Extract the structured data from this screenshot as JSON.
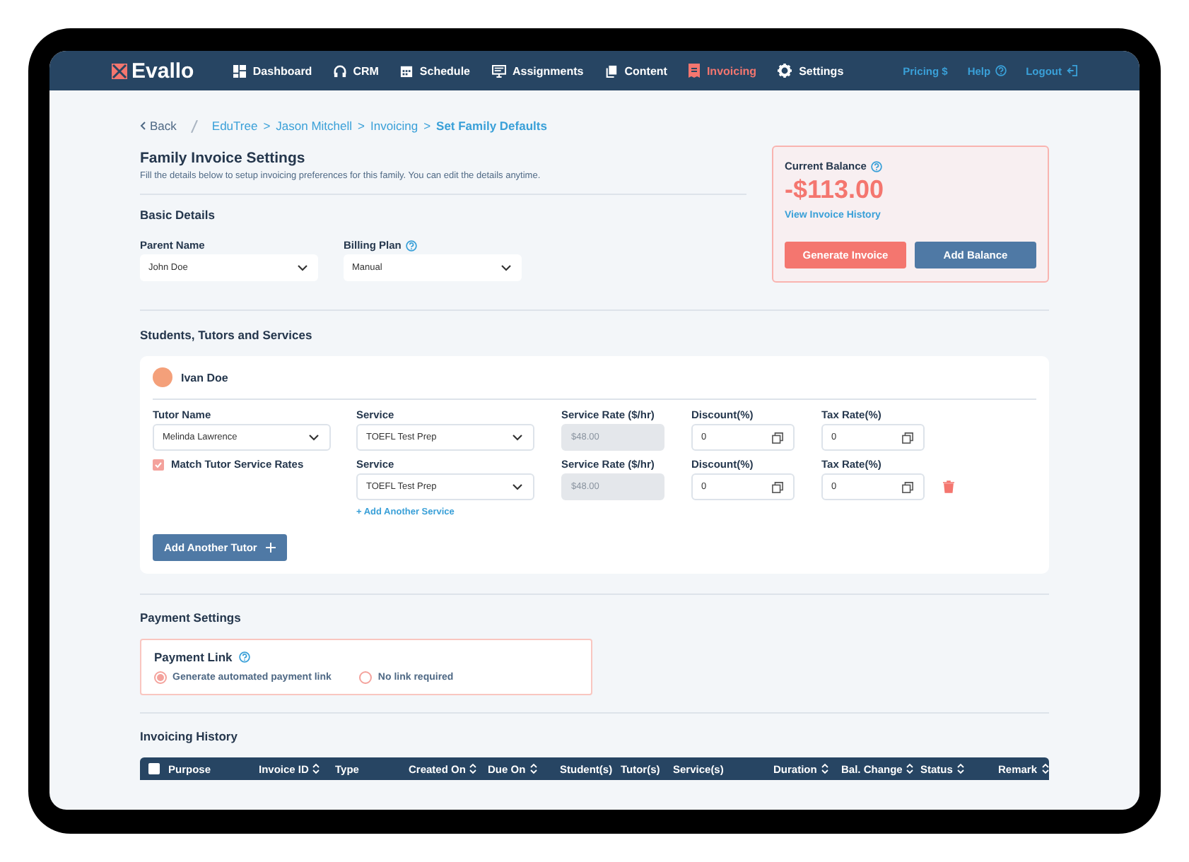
{
  "app": {
    "logo": "Evallo"
  },
  "nav": [
    {
      "label": "Dashboard",
      "selected": false
    },
    {
      "label": "CRM",
      "selected": false
    },
    {
      "label": "Schedule",
      "selected": false
    },
    {
      "label": "Assignments",
      "selected": false
    },
    {
      "label": "Content",
      "selected": false
    },
    {
      "label": "Invoicing",
      "selected": true
    },
    {
      "label": "Settings",
      "selected": false
    }
  ],
  "top_links": [
    "Pricing $",
    "Help",
    "Logout"
  ],
  "breadcrumb": {
    "back": "Back",
    "items": [
      {
        "label": "EduTree",
        "kind": "link"
      },
      {
        "label": ">",
        "kind": "sep"
      },
      {
        "label": "Jason Mitchell",
        "kind": "link"
      },
      {
        "label": ">",
        "kind": "sep"
      },
      {
        "label": "Invoicing",
        "kind": "link"
      },
      {
        "label": ">",
        "kind": "sep"
      },
      {
        "label": "Set Family Defaults",
        "kind": "current"
      }
    ]
  },
  "page": {
    "title": "Family Invoice Settings",
    "subtitle": "Fill the details below to setup invoicing preferences for this family. You can edit the details anytime."
  },
  "basic_details": {
    "heading": "Basic Details",
    "fields": [
      {
        "label": "Parent Name",
        "value": "John Doe",
        "help": false
      },
      {
        "label": "Billing Plan",
        "value": "Manual",
        "help": true
      }
    ]
  },
  "balance": {
    "label": "Current Balance",
    "amount": "-$113.00",
    "link": "View Invoice History",
    "buttons": [
      {
        "label": "Generate Invoice",
        "kind": "primary"
      },
      {
        "label": "Add Balance",
        "kind": "secondary"
      }
    ]
  },
  "students": {
    "heading": "Students, Tutors and Services",
    "student": {
      "name": "Ivan Doe"
    },
    "tutor": {
      "label": "Tutor Name",
      "value": "Melinda Lawrence",
      "match_rates": {
        "label": "Match Tutor Service Rates",
        "checked": true
      }
    },
    "services": [
      {
        "service_label": "Service",
        "service": "TOEFL Test Prep",
        "rate_label": "Service Rate ($/hr)",
        "rate": "$48.00",
        "discount_label": "Discount(%)",
        "discount": "0",
        "tax_label": "Tax Rate(%)",
        "tax": "0",
        "deletable": false
      },
      {
        "service_label": "Service",
        "service": "TOEFL Test Prep",
        "rate_label": "Service Rate ($/hr)",
        "rate": "$48.00",
        "discount_label": "Discount(%)",
        "discount": "0",
        "tax_label": "Tax Rate(%)",
        "tax": "0",
        "deletable": true
      }
    ],
    "add_service": "+ Add Another Service",
    "add_tutor": "Add Another Tutor"
  },
  "payment": {
    "heading": "Payment Settings",
    "link_label": "Payment Link",
    "options": [
      {
        "label": "Generate automated payment link",
        "selected": true
      },
      {
        "label": "No link required",
        "selected": false
      }
    ]
  },
  "history": {
    "heading": "Invoicing History",
    "select_all": {
      "checked": false
    },
    "columns": [
      {
        "label": "Purpose",
        "sortable": false
      },
      {
        "label": "Invoice ID",
        "sortable": true
      },
      {
        "label": "Type",
        "sortable": false
      },
      {
        "label": "Created On",
        "sortable": true
      },
      {
        "label": "Due On",
        "sortable": true
      },
      {
        "label": "Student(s)",
        "sortable": false
      },
      {
        "label": "Tutor(s)",
        "sortable": false
      },
      {
        "label": "Service(s)",
        "sortable": false
      },
      {
        "label": "Duration",
        "sortable": true
      },
      {
        "label": "Bal. Change",
        "sortable": true
      },
      {
        "label": "Status",
        "sortable": true
      },
      {
        "label": "Remark",
        "sortable": true
      }
    ]
  }
}
